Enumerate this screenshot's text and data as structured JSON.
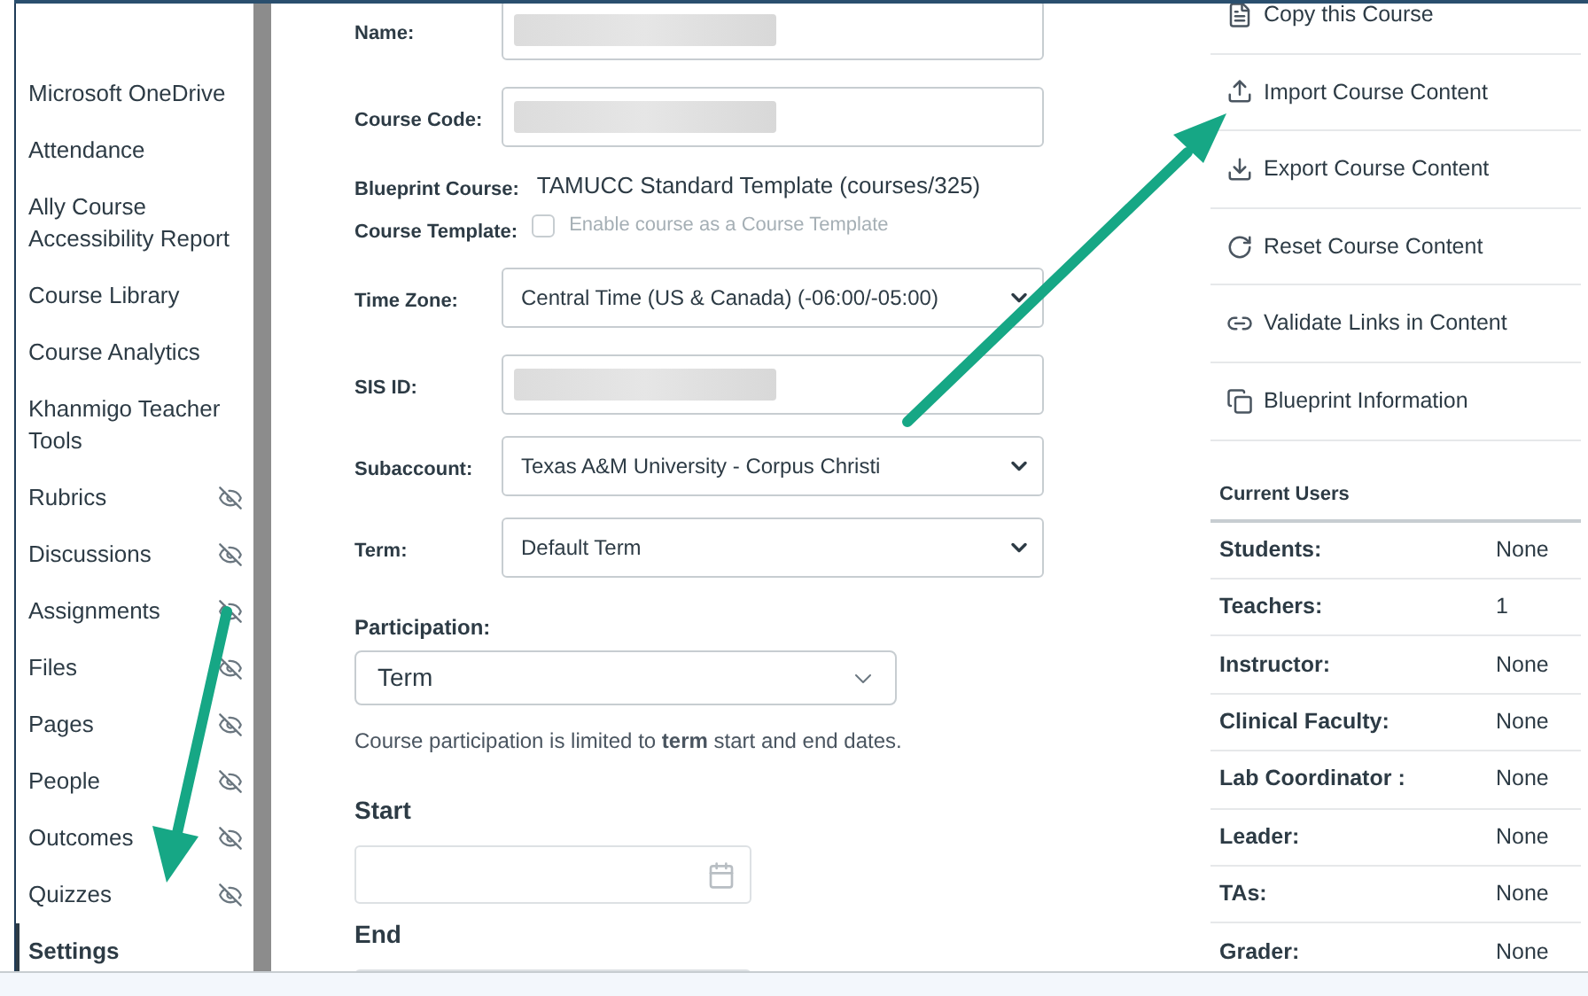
{
  "sidebar": {
    "items": [
      {
        "label": "Microsoft OneDrive",
        "hidden": false,
        "selected": false
      },
      {
        "label": "Attendance",
        "hidden": false,
        "selected": false
      },
      {
        "label": "Ally Course Accessibility Report",
        "hidden": false,
        "selected": false
      },
      {
        "label": "Course Library",
        "hidden": false,
        "selected": false
      },
      {
        "label": "Course Analytics",
        "hidden": false,
        "selected": false
      },
      {
        "label": "Khanmigo Teacher Tools",
        "hidden": false,
        "selected": false
      },
      {
        "label": "Rubrics",
        "hidden": true,
        "selected": false
      },
      {
        "label": "Discussions",
        "hidden": true,
        "selected": false
      },
      {
        "label": "Assignments",
        "hidden": true,
        "selected": false
      },
      {
        "label": "Files",
        "hidden": true,
        "selected": false
      },
      {
        "label": "Pages",
        "hidden": true,
        "selected": false
      },
      {
        "label": "People",
        "hidden": true,
        "selected": false
      },
      {
        "label": "Outcomes",
        "hidden": true,
        "selected": false
      },
      {
        "label": "Quizzes",
        "hidden": true,
        "selected": false
      },
      {
        "label": "Settings",
        "hidden": false,
        "selected": true
      }
    ]
  },
  "form": {
    "fields": [
      {
        "kind": "redacted",
        "label": "Name:"
      },
      {
        "kind": "redacted",
        "label": "Course Code:"
      },
      {
        "kind": "info",
        "label": "Blueprint Course:",
        "value": "TAMUCC Standard Template (courses/325)"
      },
      {
        "kind": "checkbox",
        "label": "Course Template:",
        "checkbox_label": "Enable course as a Course Template",
        "checked": false,
        "disabled": true
      },
      {
        "kind": "select",
        "label": "Time Zone:",
        "value": "Central Time (US & Canada) (-06:00/-05:00)"
      },
      {
        "kind": "redacted",
        "label": "SIS ID:"
      },
      {
        "kind": "select",
        "label": "Subaccount:",
        "value": "Texas A&M University - Corpus Christi"
      },
      {
        "kind": "select",
        "label": "Term:",
        "value": "Default Term"
      }
    ],
    "participation": {
      "label": "Participation:",
      "value": "Term",
      "help": "Course participation is limited to **term** start and end dates."
    },
    "start_label": "Start",
    "end_label": "End"
  },
  "actions": [
    {
      "kind": "copy",
      "label": "Copy this Course"
    },
    {
      "kind": "import",
      "label": "Import Course Content"
    },
    {
      "kind": "export",
      "label": "Export Course Content"
    },
    {
      "kind": "reset",
      "label": "Reset Course Content"
    },
    {
      "kind": "link",
      "label": "Validate Links in Content"
    },
    {
      "kind": "blueprint",
      "label": "Blueprint Information"
    }
  ],
  "current_users": {
    "title": "Current Users",
    "rows": [
      {
        "label": "Students:",
        "value": "None"
      },
      {
        "label": "Teachers:",
        "value": "1"
      },
      {
        "label": "Instructor:",
        "value": "None"
      },
      {
        "label": "Clinical Faculty:",
        "value": "None"
      },
      {
        "label": "Lab Coordinator :",
        "value": "None"
      },
      {
        "label": "Leader:",
        "value": "None"
      },
      {
        "label": "TAs:",
        "value": "None"
      },
      {
        "label": "Grader:",
        "value": "None"
      }
    ]
  }
}
